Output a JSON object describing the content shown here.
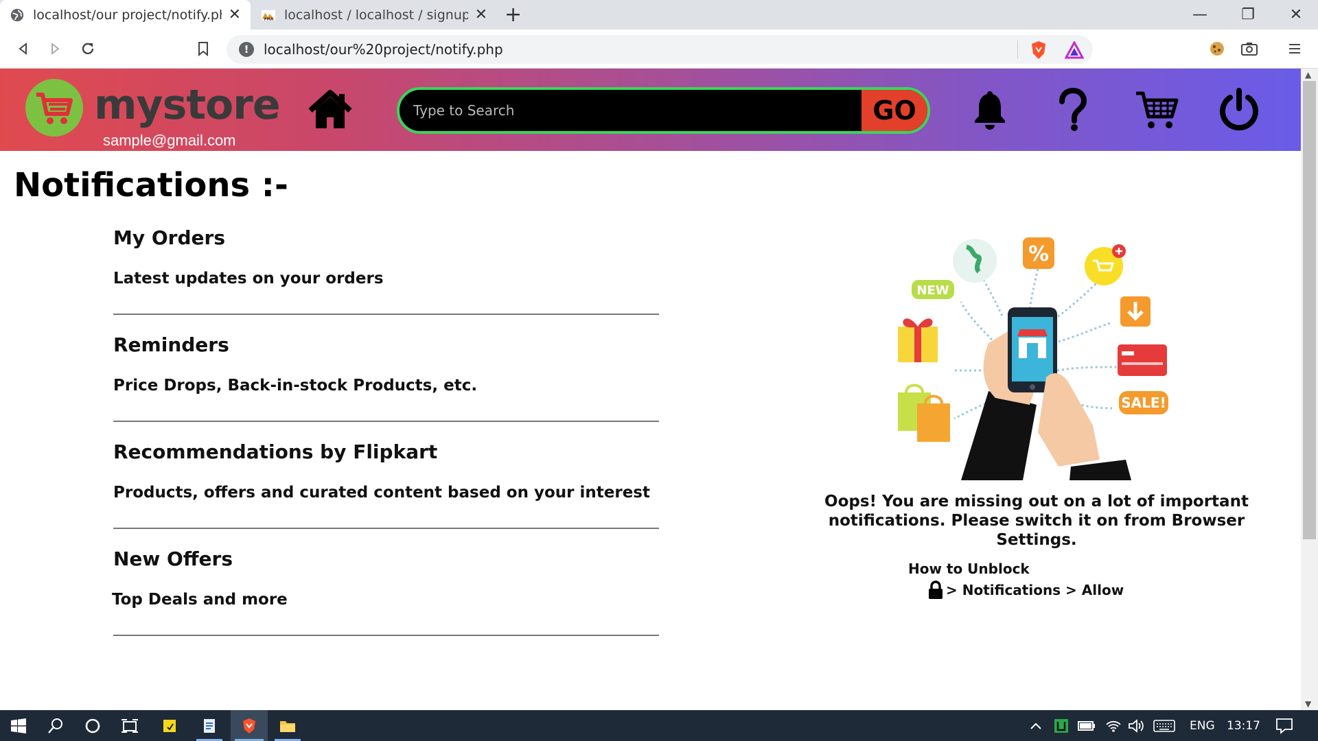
{
  "browser": {
    "tabs": [
      {
        "title": "localhost/our project/notify.php"
      },
      {
        "title": "localhost / localhost / signup | php"
      }
    ],
    "url": "localhost/our%20project/notify.php"
  },
  "header": {
    "brand": "mystore",
    "email": "sample@gmail.com",
    "search_placeholder": "Type to Search",
    "go_label": "GO"
  },
  "page": {
    "title": "Notifications :-",
    "sections": [
      {
        "heading": "My Orders",
        "desc": "Latest updates on your orders"
      },
      {
        "heading": "Reminders",
        "desc": "Price Drops, Back-in-stock Products, etc."
      },
      {
        "heading": "Recommendations by Flipkart",
        "desc": "Products, offers and curated content based on your interest"
      },
      {
        "heading": "New Offers",
        "desc": "Top Deals and more"
      }
    ],
    "oops_line1": "Oops! You are missing out on a lot of important",
    "oops_line2": "notifications. Please switch it on from Browser Settings.",
    "howto": "How to Unblock",
    "path": "> Notifications > Allow",
    "illustration_labels": {
      "new": "NEW",
      "percent": "%",
      "sale": "SALE!"
    }
  },
  "taskbar": {
    "lang": "ENG",
    "time": "13:17"
  }
}
